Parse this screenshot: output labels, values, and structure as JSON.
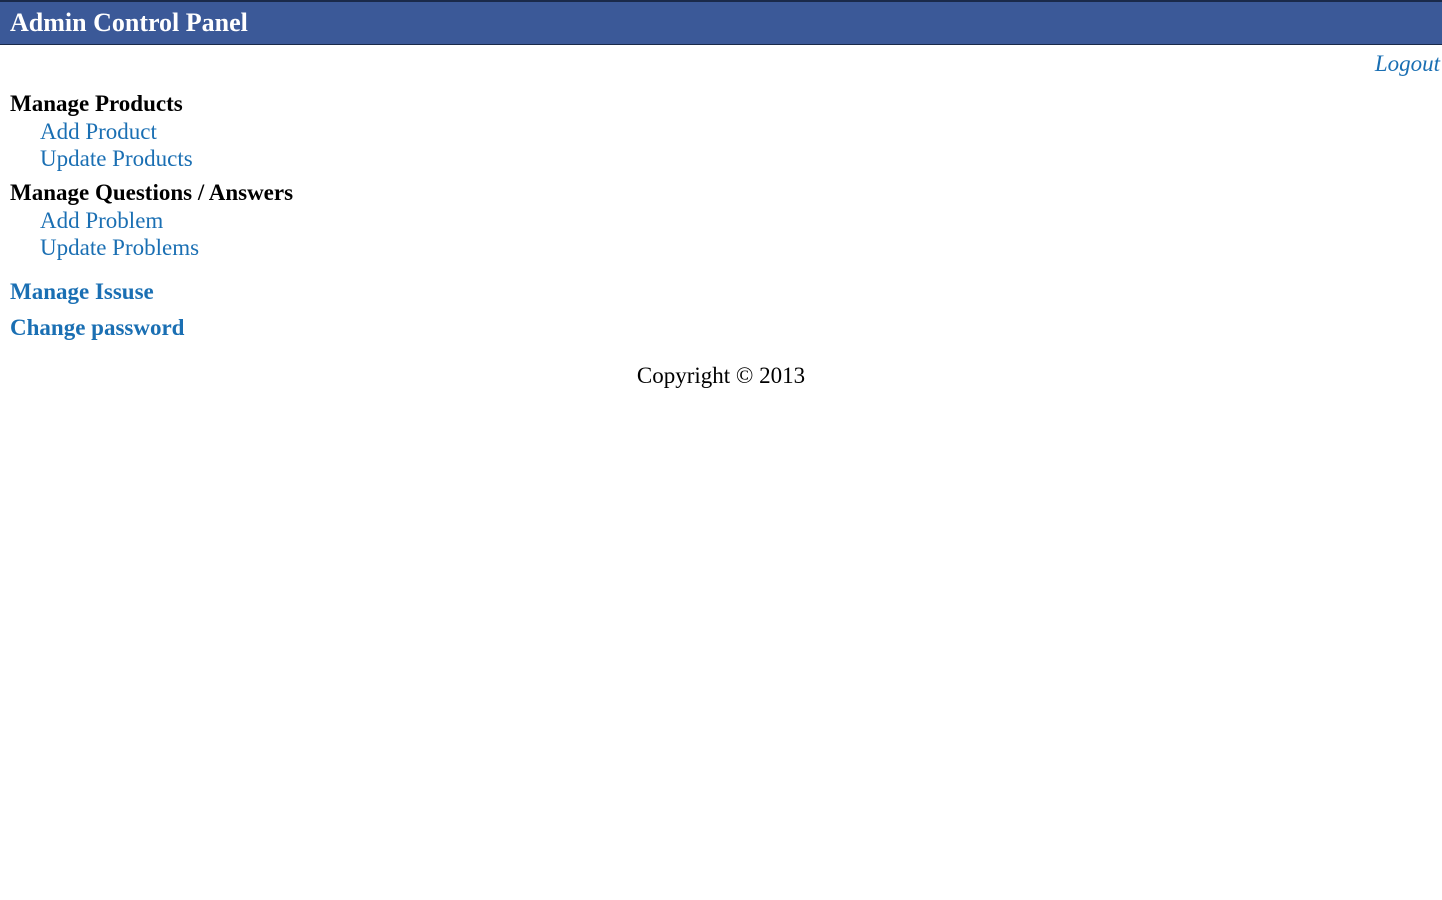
{
  "header": {
    "title": "Admin Control Panel",
    "logout": "Logout"
  },
  "sections": {
    "products": {
      "heading": "Manage Products",
      "add": "Add Product",
      "update": "Update Products"
    },
    "questions": {
      "heading": "Manage Questions / Answers",
      "add": "Add Problem",
      "update": "Update Problems"
    },
    "issues": "Manage Issuse",
    "password": "Change password"
  },
  "footer": {
    "copyright": "Copyright © 2013"
  }
}
